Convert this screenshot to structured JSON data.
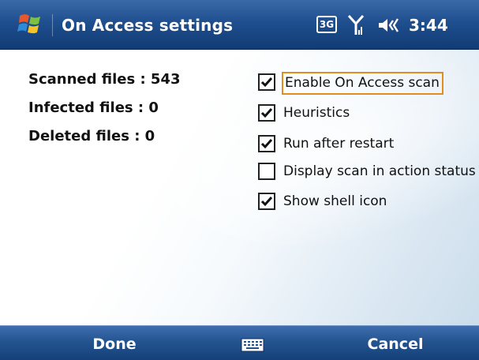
{
  "titlebar": {
    "title": "On Access settings",
    "network_badge": "3G",
    "time": "3:44",
    "icons": [
      "windows-start-icon",
      "signal-icon",
      "volume-icon"
    ]
  },
  "stats": {
    "scanned": "Scanned files : 543",
    "infected": "Infected files : 0",
    "deleted": "Deleted files : 0"
  },
  "options": [
    {
      "label": "Enable On Access scan",
      "checked": true,
      "focused": true
    },
    {
      "label": "Heuristics",
      "checked": true,
      "focused": false
    },
    {
      "label": "Run after restart",
      "checked": true,
      "focused": false
    },
    {
      "label": "Display scan in action status",
      "checked": false,
      "focused": false
    },
    {
      "label": "Show shell icon",
      "checked": true,
      "focused": false
    }
  ],
  "softkeys": {
    "left": "Done",
    "right": "Cancel",
    "center_icon": "keyboard-icon"
  },
  "colors": {
    "titlebar": "#1f4f8f",
    "focus_outline": "#e08e1e",
    "softbar": "#24548f"
  }
}
